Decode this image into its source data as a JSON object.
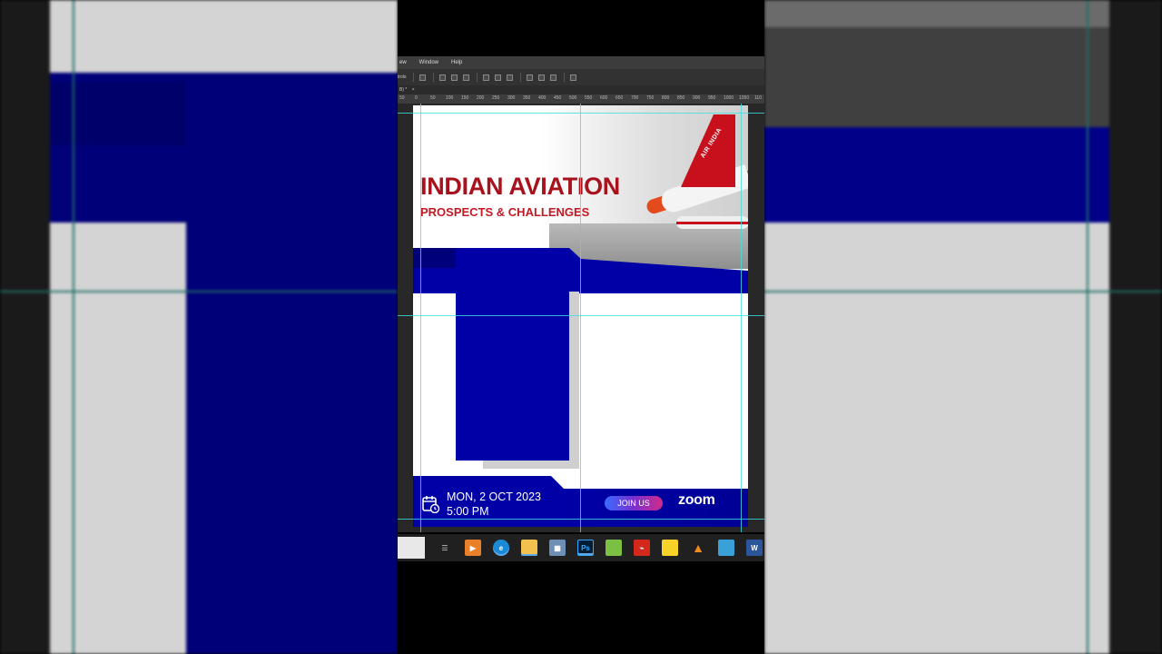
{
  "menubar": {
    "items": [
      "ew",
      "Window",
      "Help"
    ]
  },
  "options_label": "trols",
  "tab_label": "B) *",
  "ruler_ticks": [
    "50",
    "0",
    "50",
    "100",
    "150",
    "200",
    "250",
    "300",
    "350",
    "400",
    "450",
    "500",
    "550",
    "600",
    "650",
    "700",
    "750",
    "800",
    "850",
    "900",
    "950",
    "1000",
    "1050",
    "110"
  ],
  "poster": {
    "title": "INDIAN AVIATION",
    "subtitle": "PROSPECTS & CHALLENGES",
    "date": "MON, 2 OCT 2023",
    "time": "5:00 PM",
    "join_label": "JOIN US",
    "brand": "zoom",
    "plane_livery": "AIR INDIA"
  },
  "taskbar": {
    "icons": [
      "app-thumbnail-icon",
      "task-view-icon",
      "media-player-icon",
      "edge-icon",
      "file-explorer-icon",
      "calculator-icon",
      "photoshop-icon",
      "notepad-plus-icon",
      "acrobat-icon",
      "sticky-notes-icon",
      "vlc-icon",
      "paint-icon",
      "word-icon"
    ],
    "labels": {
      "photoshop": "Ps",
      "word": "W"
    }
  },
  "colors": {
    "navy": "#0000a6",
    "title_red": "#a8121d",
    "guide": "#3fe0e0"
  }
}
